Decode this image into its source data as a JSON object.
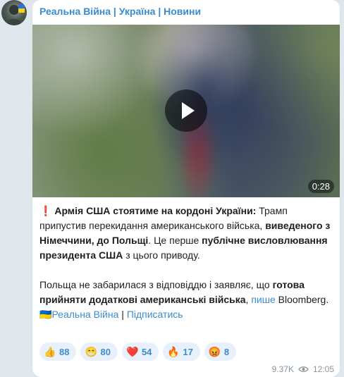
{
  "post": {
    "channel_name": "Реальна Війна | Україна | Новини",
    "video": {
      "duration": "0:28"
    },
    "text": {
      "p1_marker": "❗",
      "p1_bold1": "Армія США стоятиме на кордоні України:",
      "p1_t1": " Трамп припустив перекидання американського війська, ",
      "p1_bold2": "виведеного з Німеччини, до Польщі",
      "p1_t2": ". Це перше ",
      "p1_bold3": "публічне висловлювання президента США",
      "p1_t3": " з цього приводу.",
      "p2_t1": "Польща не забарилася з відповіддю і заявляє, що ",
      "p2_bold1": "готова прийняти додаткові американські війська",
      "p2_t2": ", ",
      "p2_link": "пише",
      "p2_t3": " Bloomberg.",
      "footer_flag": "🇺🇦",
      "footer_channel_link": "Реальна Війна",
      "footer_sep": " | ",
      "footer_subscribe_link": "Підписатись"
    },
    "reactions": [
      {
        "emoji": "👍",
        "count": "88"
      },
      {
        "emoji": "😁",
        "count": "80"
      },
      {
        "emoji": "❤️",
        "count": "54"
      },
      {
        "emoji": "🔥",
        "count": "17"
      },
      {
        "emoji": "😡",
        "count": "8"
      }
    ],
    "views": "9.37K",
    "time": "12:05"
  },
  "colors": {
    "accent": "#3a8ccf",
    "background": "#dfe7ec",
    "bubble": "#ffffff"
  }
}
